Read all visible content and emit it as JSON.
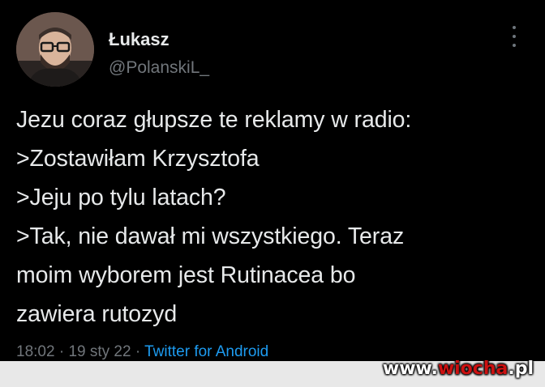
{
  "colors": {
    "background": "#000000",
    "text": "#e7e9ea",
    "muted": "#71767b",
    "link": "#1d9bf0"
  },
  "author": {
    "display_name": "Łukasz",
    "handle": "@PolanskiL_",
    "avatar": "user-avatar-photo"
  },
  "tweet": {
    "lines": [
      "Jezu coraz głupsze te reklamy w radio:",
      ">Zostawiłam Krzysztofa",
      ">Jeju po tylu latach?",
      ">Tak, nie dawał mi wszystkiego. Teraz",
      "moim wyborem jest Rutinacea bo",
      "zawiera rutozyd"
    ]
  },
  "meta": {
    "time": "18:02",
    "separator": " · ",
    "date": "19 sty 22",
    "source": "Twitter for Android"
  },
  "watermark": {
    "prefix": "www.",
    "brand": "wiocha",
    "suffix": ".pl"
  },
  "icons": {
    "more": "more-vertical-icon"
  }
}
